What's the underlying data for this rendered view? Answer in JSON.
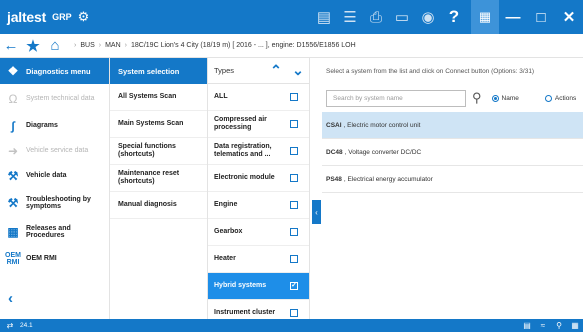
{
  "app": {
    "logo_text": "jaltest",
    "product": "GRP",
    "status_version": "24.1"
  },
  "topbar_icons": [
    "document-icon",
    "list-icon",
    "print-icon",
    "camera-icon",
    "help-icon",
    "apps-grid-icon",
    "minimize-icon",
    "close-icon"
  ],
  "breadcrumb": {
    "items": [
      "BUS",
      "MAN",
      "18C/19C Lion's 4 City (18/19 m) [ 2016 - ... ], engine: D1556/E1856 LOH"
    ]
  },
  "sidebar": {
    "header": "Diagnostics menu",
    "items": [
      {
        "label": "System technical data",
        "icon": "omega-icon",
        "enabled": false
      },
      {
        "label": "Diagrams",
        "icon": "diagram-icon",
        "enabled": true
      },
      {
        "label": "Vehicle service data",
        "icon": "service-icon",
        "enabled": false
      },
      {
        "label": "Vehicle data",
        "icon": "wrench-icon",
        "enabled": true
      },
      {
        "label": "Troubleshooting by symptoms",
        "icon": "troubleshooting-icon",
        "enabled": true
      },
      {
        "label": "Releases and Procedures",
        "icon": "procedures-icon",
        "enabled": true
      },
      {
        "label": "OEM RMI",
        "icon": "oem-rmi-icon",
        "enabled": true
      }
    ]
  },
  "systems": {
    "header": "System selection",
    "items": [
      "All Systems Scan",
      "Main Systems Scan",
      "Special functions (shortcuts)",
      "Maintenance reset (shortcuts)",
      "Manual diagnosis"
    ]
  },
  "types": {
    "header": "Types",
    "items": [
      {
        "label": "ALL",
        "checked": false
      },
      {
        "label": "Compressed air processing",
        "checked": false
      },
      {
        "label": "Data registration, telematics and ...",
        "checked": false
      },
      {
        "label": "Electronic module",
        "checked": false
      },
      {
        "label": "Engine",
        "checked": false
      },
      {
        "label": "Gearbox",
        "checked": false
      },
      {
        "label": "Heater",
        "checked": false
      },
      {
        "label": "Hybrid systems",
        "checked": true
      },
      {
        "label": "Instrument cluster",
        "checked": false
      }
    ]
  },
  "main": {
    "message": "Select a system from the list and click on Connect button (Options: 3/31)",
    "search_placeholder": "Search by system name",
    "radio_name": "Name",
    "radio_actions": "Actions",
    "results": [
      {
        "code": "CSAI",
        "desc": ", Electric motor control unit",
        "selected": true
      },
      {
        "code": "DC48",
        "desc": ", Voltage converter DC/DC",
        "selected": false
      },
      {
        "code": "PS48",
        "desc": ", Electrical energy accumulator",
        "selected": false
      }
    ]
  },
  "colors": {
    "primary": "#1478c8",
    "selected_type": "#1e8ee8",
    "selected_row": "#cfe4f5"
  }
}
